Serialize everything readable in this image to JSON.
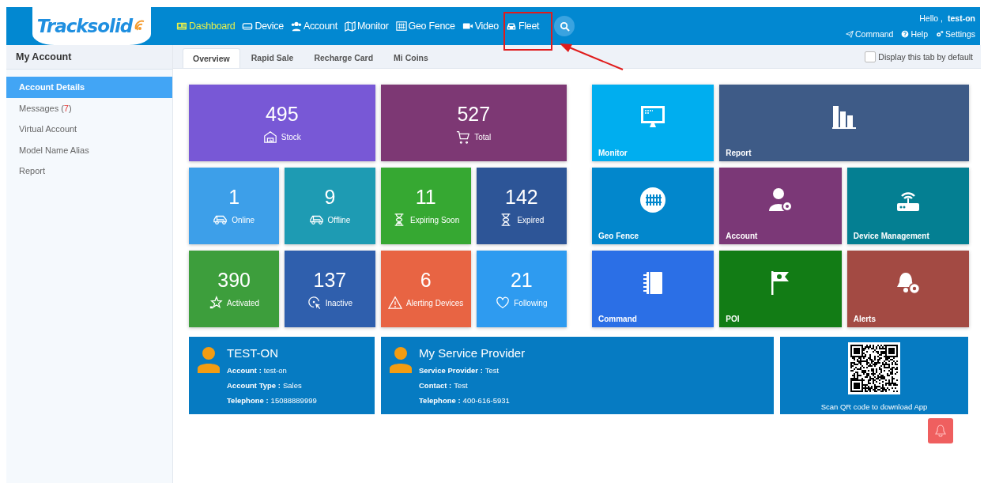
{
  "header": {
    "logo": "Tracksolid",
    "nav": [
      {
        "label": "Dashboard",
        "selected": true
      },
      {
        "label": "Device",
        "selected": false
      },
      {
        "label": "Account",
        "selected": false
      },
      {
        "label": "Monitor",
        "selected": false
      },
      {
        "label": "Geo Fence",
        "selected": false
      },
      {
        "label": "Video",
        "selected": false
      },
      {
        "label": "Fleet",
        "selected": false
      }
    ],
    "greeting": "Hello ,",
    "user": "test-on",
    "links": [
      {
        "label": "Command"
      },
      {
        "label": "Help"
      },
      {
        "label": "Settings"
      }
    ]
  },
  "sidebar": {
    "title": "My Account",
    "items": [
      {
        "label": "Account Details",
        "selected": true
      },
      {
        "label": "Messages (",
        "count": "7",
        "label_end": ")",
        "selected": false
      },
      {
        "label": "Virtual Account",
        "selected": false
      },
      {
        "label": "Model Name Alias",
        "selected": false
      },
      {
        "label": "Report",
        "selected": false
      }
    ]
  },
  "tabs": [
    {
      "label": "Overview",
      "selected": true
    },
    {
      "label": "Rapid Sale",
      "selected": false
    },
    {
      "label": "Recharge Card",
      "selected": false
    },
    {
      "label": "Mi Coins",
      "selected": false
    }
  ],
  "default_tab_option": {
    "label": "Display this tab by default",
    "checked": false
  },
  "stats": [
    {
      "value": "495",
      "label": "Stock",
      "color": "#7858d6"
    },
    {
      "value": "527",
      "label": "Total",
      "color": "#7d3874"
    },
    {
      "value": "1",
      "label": "Online",
      "color": "#3d9fe9"
    },
    {
      "value": "9",
      "label": "Offline",
      "color": "#1e9bb3"
    },
    {
      "value": "11",
      "label": "Expiring Soon",
      "color": "#36a832"
    },
    {
      "value": "142",
      "label": "Expired",
      "color": "#2d5597"
    },
    {
      "value": "390",
      "label": "Activated",
      "color": "#3d9e3c"
    },
    {
      "value": "137",
      "label": "Inactive",
      "color": "#2f5fad"
    },
    {
      "value": "6",
      "label": "Alerting Devices",
      "color": "#e86443"
    },
    {
      "value": "21",
      "label": "Following",
      "color": "#2e9bf0"
    }
  ],
  "shortcuts": [
    {
      "label": "Monitor",
      "color": "#00aeef"
    },
    {
      "label": "Report",
      "color": "#3e5b87"
    },
    {
      "label": "Geo Fence",
      "color": "#0287cc"
    },
    {
      "label": "Account",
      "color": "#7b3877"
    },
    {
      "label": "Device Management",
      "color": "#047f92"
    },
    {
      "label": "Command",
      "color": "#2b6fe6"
    },
    {
      "label": "POI",
      "color": "#127c15"
    },
    {
      "label": "Alerts",
      "color": "#a34a43"
    }
  ],
  "profile": {
    "title": "TEST-ON",
    "rows": [
      {
        "key": "Account :",
        "value": "test-on"
      },
      {
        "key": "Account Type :",
        "value": "Sales"
      },
      {
        "key": "Telephone :",
        "value": "15088889999"
      }
    ]
  },
  "provider": {
    "title": "My Service Provider",
    "rows": [
      {
        "key": "Service Provider :",
        "value": "Test"
      },
      {
        "key": "Contact :",
        "value": "Test"
      },
      {
        "key": "Telephone :",
        "value": "400-616-5931"
      }
    ]
  },
  "app_download": {
    "caption": "Scan QR code to download App"
  }
}
